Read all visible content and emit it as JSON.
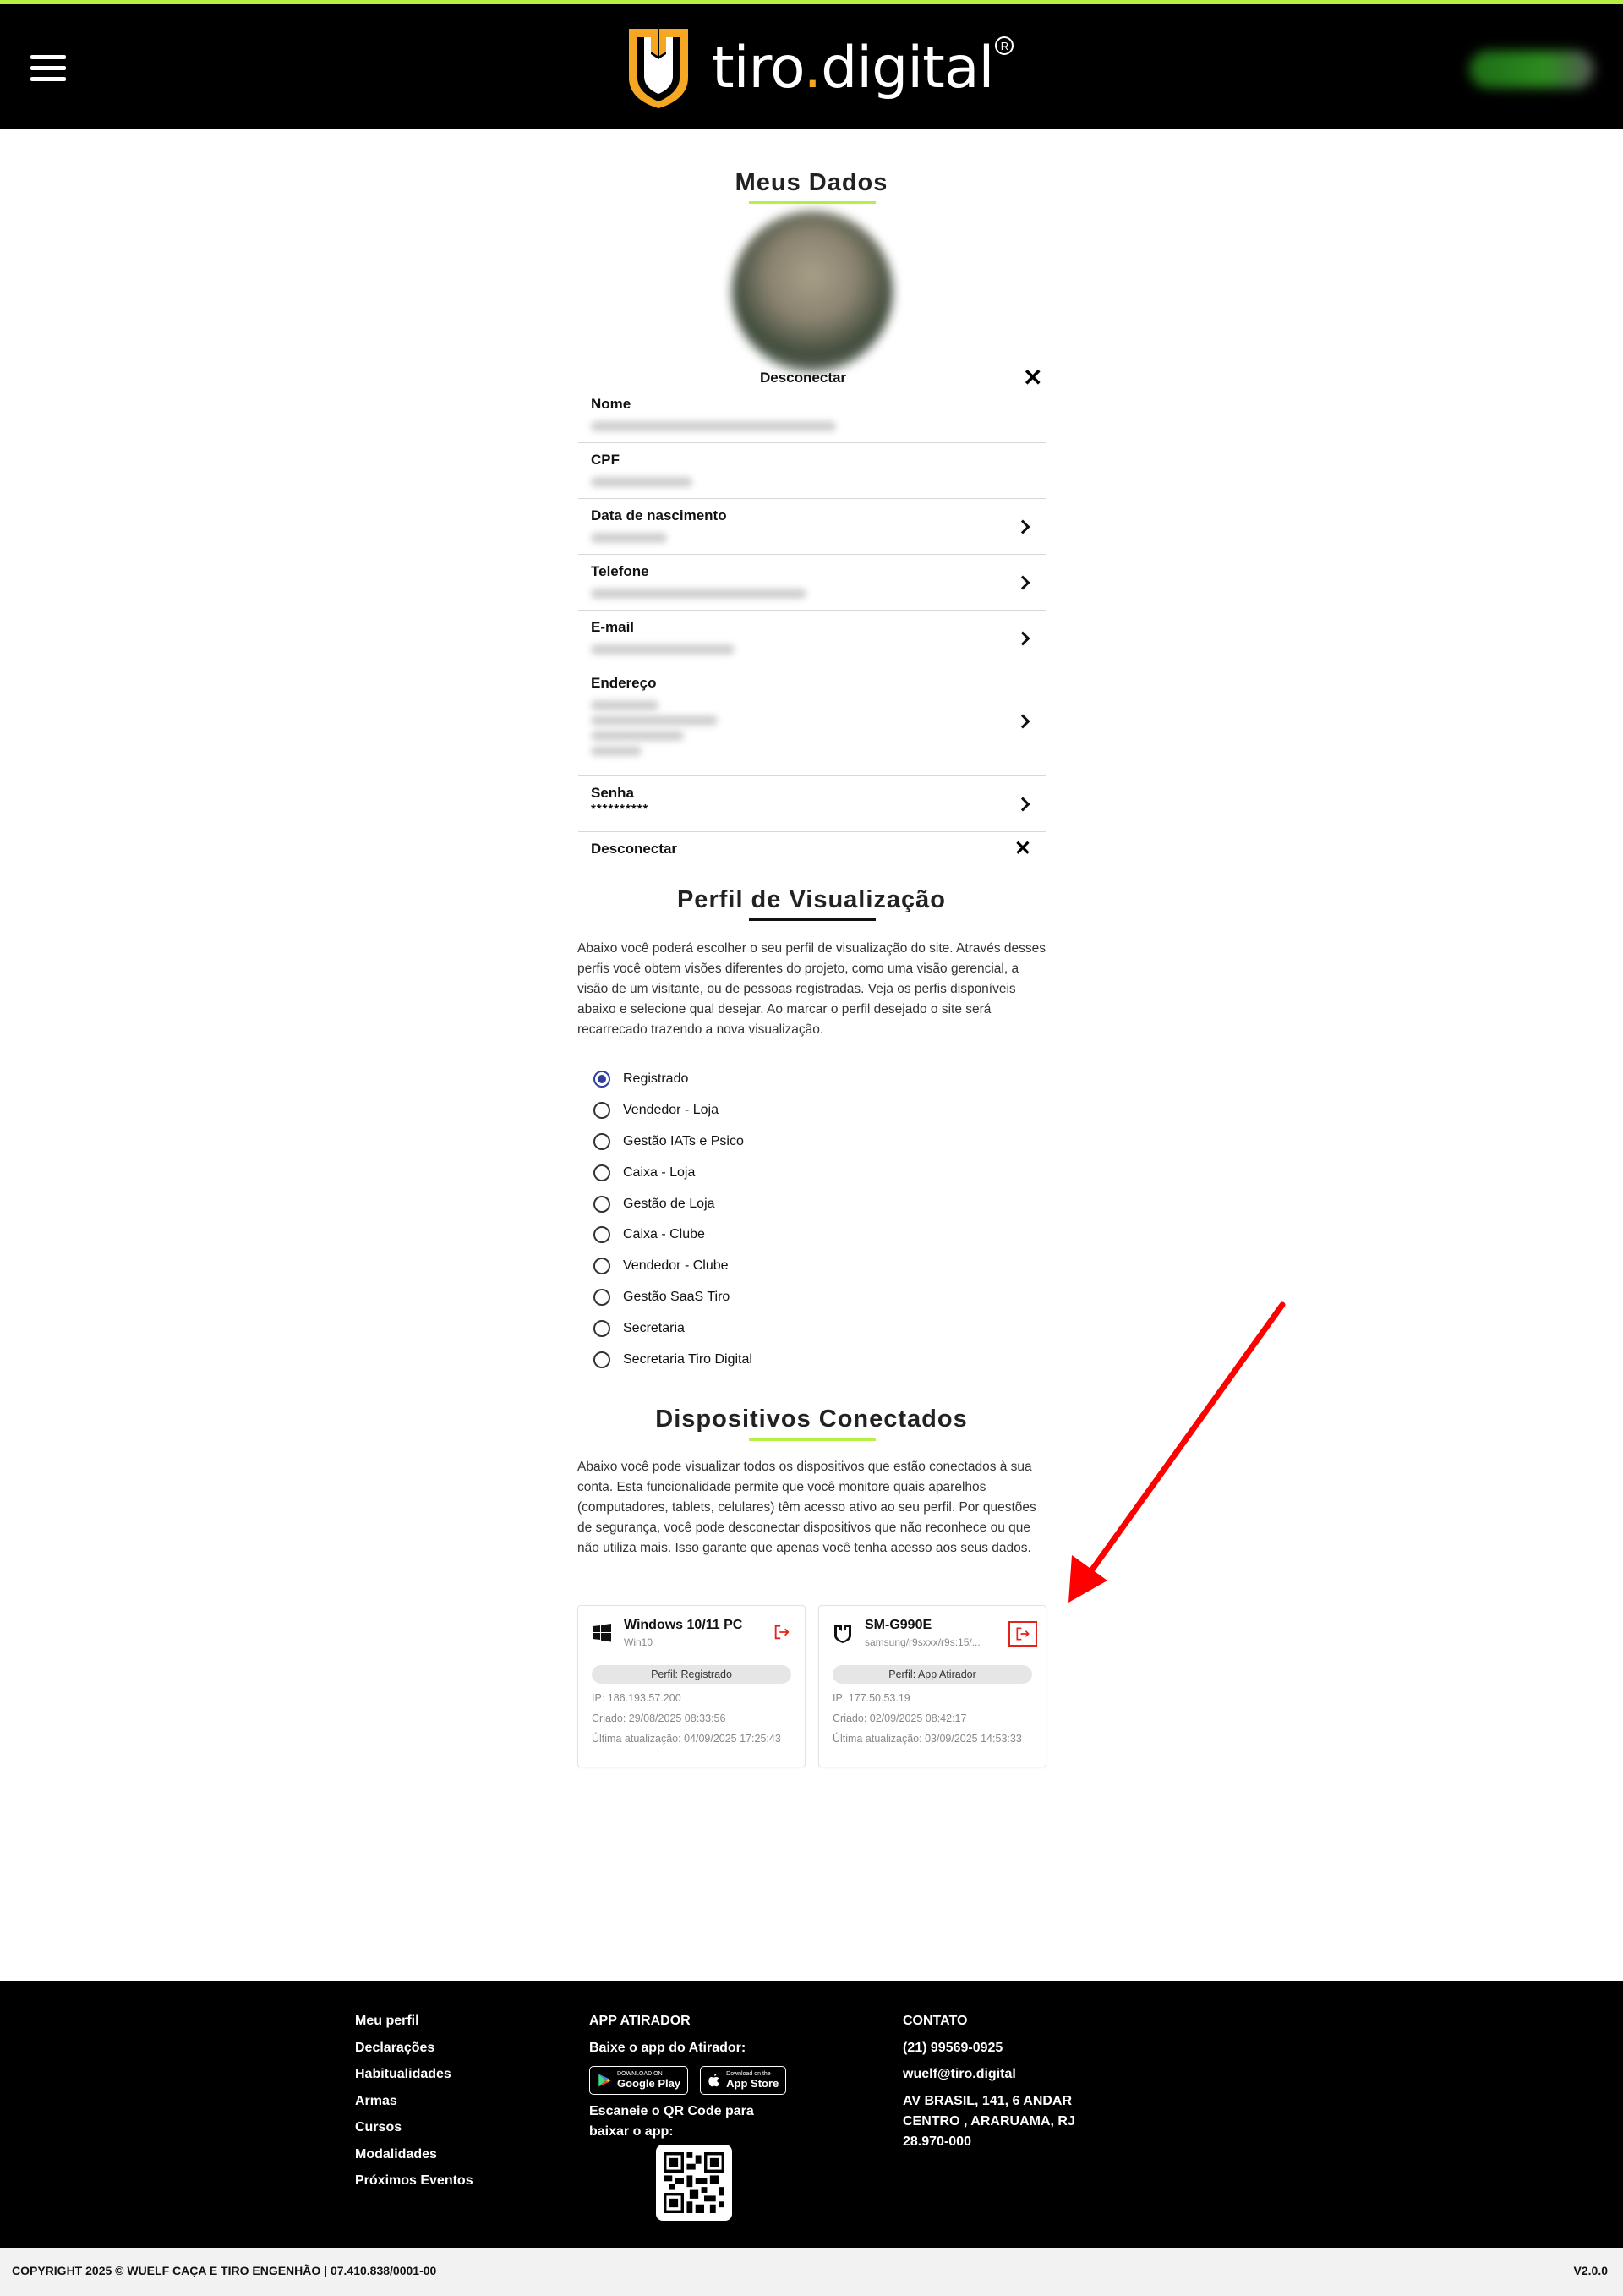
{
  "header": {
    "brand": "tiro",
    "brand_dot": ".",
    "brand_suffix": "digital",
    "registered": "R"
  },
  "profile": {
    "title": "Meus Dados",
    "avatar_disconnect": "Desconectar",
    "fields": {
      "nome": "Nome",
      "cpf": "CPF",
      "nascimento": "Data de nascimento",
      "telefone": "Telefone",
      "email": "E-mail",
      "endereco": "Endereço",
      "senha": "Senha",
      "senha_value": "**********",
      "desconectar": "Desconectar"
    }
  },
  "view_profile": {
    "title": "Perfil de Visualização",
    "description": "Abaixo você poderá escolher o seu perfil de visualização do site. Através desses perfis você obtem visões diferentes do projeto, como uma visão gerencial, a visão de um visitante, ou de pessoas registradas. Veja os perfis disponíveis abaixo e selecione qual desejar. Ao marcar o perfil desejado o site será recarrecado trazendo a nova visualização.",
    "options": [
      {
        "label": "Registrado",
        "checked": true
      },
      {
        "label": "Vendedor - Loja",
        "checked": false
      },
      {
        "label": "Gestão IATs e Psico",
        "checked": false
      },
      {
        "label": "Caixa - Loja",
        "checked": false
      },
      {
        "label": "Gestão de Loja",
        "checked": false
      },
      {
        "label": "Caixa - Clube",
        "checked": false
      },
      {
        "label": "Vendedor - Clube",
        "checked": false
      },
      {
        "label": "Gestão SaaS Tiro",
        "checked": false
      },
      {
        "label": "Secretaria",
        "checked": false
      },
      {
        "label": "Secretaria Tiro Digital",
        "checked": false
      }
    ]
  },
  "devices": {
    "title": "Dispositivos Conectados",
    "description": "Abaixo você pode visualizar todos os dispositivos que estão conectados à sua conta. Esta funcionalidade permite que você monitore quais aparelhos (computadores, tablets, celulares) têm acesso ativo ao seu perfil. Por questões de segurança, você pode desconectar dispositivos que não reconhece ou que não utiliza mais. Isso garante que apenas você tenha acesso aos seus dados.",
    "items": [
      {
        "name": "Windows 10/11 PC",
        "sub": "Win10",
        "icon": "windows-icon",
        "profile": "Perfil: Registrado",
        "ip": "IP: 186.193.57.200",
        "created": "Criado: 29/08/2025 08:33:56",
        "updated": "Última atualização: 04/09/2025 17:25:43"
      },
      {
        "name": "SM-G990E",
        "sub": "samsung/r9sxxx/r9s:15/...",
        "icon": "tiro-app-icon",
        "profile": "Perfil: App Atirador",
        "ip": "IP: 177.50.53.19",
        "created": "Criado: 02/09/2025 08:42:17",
        "updated": "Última atualização: 03/09/2025 14:53:33"
      }
    ]
  },
  "footer": {
    "links": [
      "Meu perfil",
      "Declarações",
      "Habitualidades",
      "Armas",
      "Cursos",
      "Modalidades",
      "Próximos Eventos"
    ],
    "app": {
      "title": "APP ATIRADOR",
      "subtitle": "Baixe o app do Atirador:",
      "google_small": "DOWNLOAD ON",
      "google_big": "Google Play",
      "apple_small": "Download on the",
      "apple_big": "App Store",
      "qr_text": "Escaneie o QR Code para baixar o app:"
    },
    "contact": {
      "title": "CONTATO",
      "phone": "(21) 99569-0925",
      "email": "wuelf@tiro.digital",
      "address1": "AV BRASIL, 141, 6 ANDAR",
      "address2": "CENTRO , ARARUAMA, RJ",
      "address3": "28.970-000"
    },
    "copyright": "COPYRIGHT 2025 © WUELF CAÇA E TIRO ENGENHÃO | 07.410.838/0001-00",
    "version": "V2.0.0"
  },
  "colors": {
    "accent": "#b7f043",
    "brand_orange": "#f5a623",
    "logout_red": "#e2231a",
    "annotation_red": "#ff0000"
  }
}
